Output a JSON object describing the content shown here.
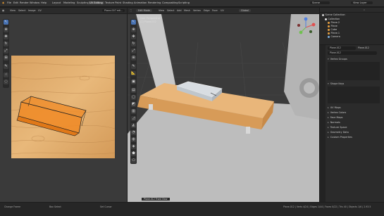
{
  "topbar": {
    "menus": [
      "File",
      "Edit",
      "Render",
      "Window",
      "Help"
    ],
    "tabs": [
      "Layout",
      "Modeling",
      "Sculpting",
      "UV Editing",
      "Texture Paint",
      "Shading",
      "Animation",
      "Rendering",
      "Compositing",
      "Scripting"
    ],
    "active_tab_index": 3,
    "scene_label": "Scene",
    "view_layer_label": "View Layer"
  },
  "uv_editor": {
    "header": [
      "View",
      "Select",
      "Image",
      "UV"
    ],
    "image_name": "Plane.007 edi...",
    "mode": "UV Editor"
  },
  "viewport": {
    "mode": "Edit Mode",
    "header": [
      "View",
      "Select",
      "Add",
      "Mesh",
      "Vertex",
      "Edge",
      "Face",
      "UV"
    ],
    "transform": "Global",
    "overlay_title": "User Perspective",
    "overlay_sub": "(1) Plane.012",
    "footer_label": "Plane.012 Front View"
  },
  "outliner": {
    "title": "Scene Collection",
    "rows": [
      "Collection",
      "Plane.2",
      "Plane",
      "Cube",
      "Plane.1",
      "Camera"
    ],
    "row_colors": [
      "#e8e8e8",
      "#e8a040",
      "#e8a040",
      "#e8a040",
      "#e8a040",
      "#7fb0e0"
    ]
  },
  "properties": {
    "object_name": "Plane.012",
    "data_name": "Plane.012",
    "mesh_name": "Plane.012",
    "sections": [
      "Vertex Groups",
      "Shape Keys",
      "UV Maps",
      "Vertex Colors",
      "Face Maps",
      "Normals",
      "Texture Space",
      "Geometry Data",
      "Custom Properties"
    ]
  },
  "statusbar": {
    "left": [
      "Change Frame",
      "Box Select",
      "Set Cursor"
    ],
    "right": "Plane.012 | Verts 4/24 | Edges 1/44 | Faces 0/22 | Tris 40 | Objects 1/6 | 2.93.5"
  },
  "colors": {
    "accent": "#4772b3",
    "wood": "#e2a869",
    "selection": "#f08a24"
  }
}
